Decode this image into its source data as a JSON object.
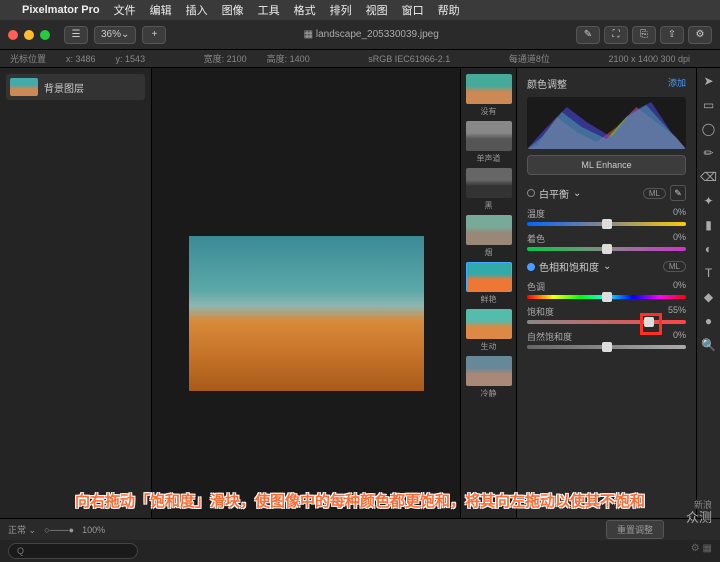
{
  "menubar": {
    "app": "Pixelmator Pro",
    "items": [
      "文件",
      "编辑",
      "插入",
      "图像",
      "工具",
      "格式",
      "排列",
      "视图",
      "窗口",
      "帮助"
    ]
  },
  "toolbar": {
    "zoom": "36%",
    "filename": "landscape_205330039.jpeg"
  },
  "infobar": {
    "cursor_label": "光标位置",
    "cursor_x": "x: 3486",
    "cursor_y": "y: 1543",
    "width": "宽度: 2100",
    "height": "高度: 1400",
    "colorspace": "sRGB IEC61966-2.1",
    "channels": "每通道8位",
    "dims": "2100 x 1400 300 dpi"
  },
  "layers": {
    "bg": "背景图层"
  },
  "presets": {
    "none": "没有",
    "mono": "单声道",
    "black": "黑",
    "smoke": "烟",
    "vivid": "鲜艳",
    "live": "生动",
    "quiet": "冷静"
  },
  "inspector": {
    "title": "颜色调整",
    "add": "添加",
    "ml": "ML Enhance",
    "wb": {
      "title": "白平衡",
      "ml": "ML",
      "temp": "温度",
      "temp_val": "0%",
      "tint": "着色",
      "tint_val": "0%"
    },
    "hsl": {
      "title": "色相和饱和度",
      "ml": "ML",
      "hue": "色调",
      "hue_val": "0%",
      "sat": "饱和度",
      "sat_val": "55%",
      "vib": "自然饱和度",
      "vib_val": "0%"
    }
  },
  "bottom": {
    "mode": "正常",
    "opacity": "100%",
    "reset": "重置调整",
    "search_ph": "Q"
  },
  "caption": "向右拖动「饱和度」滑块，使图像中的每种颜色都更饱和，将其向左拖动以使其不饱和",
  "watermark": {
    "l1": "新浪",
    "l2": "众测"
  }
}
